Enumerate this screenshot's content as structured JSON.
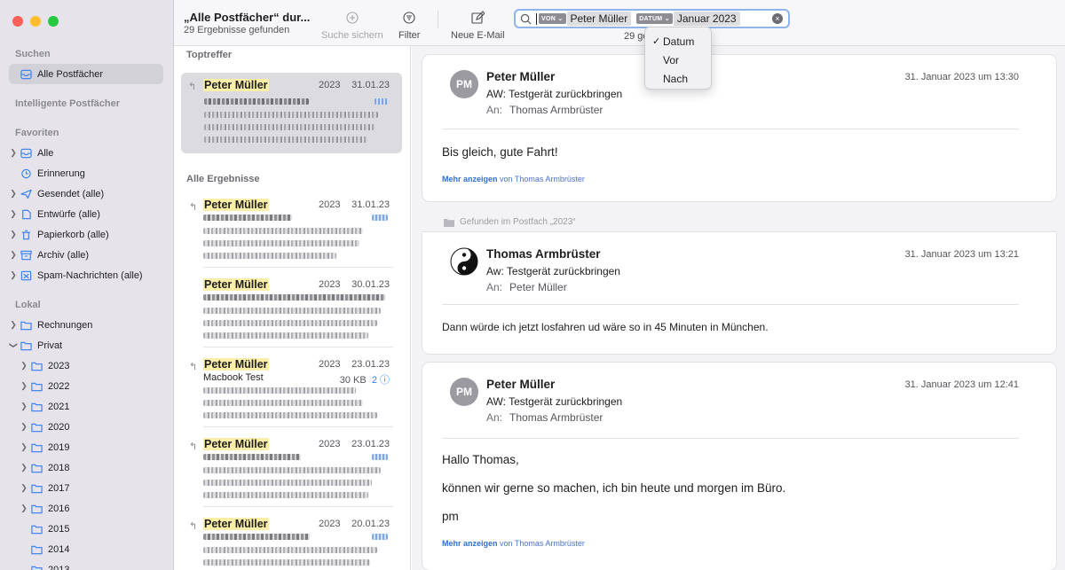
{
  "sidebar": {
    "suchen_header": "Suchen",
    "alle_postfaecher": "Alle Postfächer",
    "intelligente_header": "Intelligente Postfächer",
    "favoriten_header": "Favoriten",
    "favorites": [
      "Alle",
      "Erinnerung",
      "Gesendet (alle)",
      "Entwürfe (alle)",
      "Papierkorb (alle)",
      "Archiv (alle)",
      "Spam-Nachrichten (alle)"
    ],
    "lokal_header": "Lokal",
    "rechnungen": "Rechnungen",
    "privat": "Privat",
    "years": [
      "2023",
      "2022",
      "2021",
      "2020",
      "2019",
      "2018",
      "2017",
      "2016",
      "2015",
      "2014",
      "2013"
    ]
  },
  "toolbar": {
    "title": "„Alle Postfächer“ dur...",
    "subtitle": "29 Ergebnisse gefunden",
    "save_search": "Suche sichern",
    "filter": "Filter",
    "new_mail": "Neue E-Mail",
    "count_fragment": "29 ge"
  },
  "search": {
    "token1_type": "VON",
    "token1_value": "Peter Müller",
    "token2_type": "DATUM",
    "token2_value": "Januar 2023",
    "clear": "×"
  },
  "dropdown": {
    "options": [
      "Datum",
      "Vor",
      "Nach"
    ],
    "selected_mark": "✓"
  },
  "message_list": {
    "top_hits": "Toptreffer",
    "all_results": "Alle Ergebnisse",
    "messages": [
      {
        "from": "Peter Müller",
        "folder": "2023",
        "date": "31.01.23"
      },
      {
        "from": "Peter Müller",
        "folder": "2023",
        "date": "31.01.23"
      },
      {
        "from": "Peter Müller",
        "folder": "2023",
        "date": "30.01.23"
      },
      {
        "from": "Peter Müller",
        "folder": "2023",
        "date": "23.01.23",
        "subject": "Macbook Test",
        "size": "30 KB",
        "attachments": "2"
      },
      {
        "from": "Peter Müller",
        "folder": "2023",
        "date": "23.01.23"
      },
      {
        "from": "Peter Müller",
        "folder": "2023",
        "date": "20.01.23"
      }
    ]
  },
  "reading": {
    "found_in": "Gefunden im Postfach „2023“",
    "to_label": "An:",
    "more_link": "Mehr anzeigen",
    "more_from": "von Thomas Armbrüster",
    "emails": [
      {
        "initials": "PM",
        "from": "Peter Müller",
        "subject": "AW: Testgerät zurückbringen",
        "to": "Thomas Armbrüster",
        "date": "31. Januar 2023 um 13:30",
        "body": [
          "Bis gleich, gute Fahrt!"
        ]
      },
      {
        "initials": "",
        "from": "Thomas Armbrüster",
        "subject": "Aw: Testgerät zurückbringen",
        "to": "Peter Müller",
        "date": "31. Januar 2023 um 13:21",
        "body": [
          "Dann würde ich jetzt losfahren ud wäre so in 45 Minuten in München."
        ]
      },
      {
        "initials": "PM",
        "from": "Peter Müller",
        "subject": "AW: Testgerät zurückbringen",
        "to": "Thomas Armbrüster",
        "date": "31. Januar 2023 um 12:41",
        "body": [
          "Hallo Thomas,",
          "können wir gerne so machen, ich bin heute und morgen im Büro.",
          "pm"
        ]
      }
    ]
  }
}
